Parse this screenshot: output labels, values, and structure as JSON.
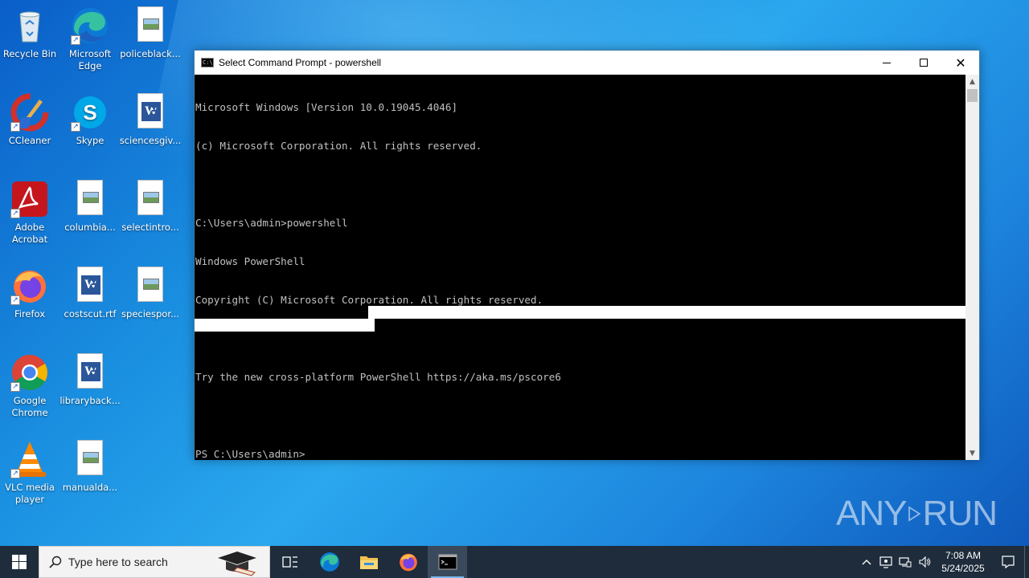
{
  "desktop": {
    "icons": [
      {
        "label": "Recycle Bin",
        "icon": "recycle-bin-icon"
      },
      {
        "label": "Microsoft Edge",
        "icon": "edge-icon"
      },
      {
        "label": "policeblack...",
        "icon": "image-file-icon"
      },
      {
        "label": "CCleaner",
        "icon": "ccleaner-icon"
      },
      {
        "label": "Skype",
        "icon": "skype-icon"
      },
      {
        "label": "sciencesgiv...",
        "icon": "word-doc-icon"
      },
      {
        "label": "Adobe Acrobat",
        "icon": "acrobat-icon"
      },
      {
        "label": "columbia...",
        "icon": "image-file-icon"
      },
      {
        "label": "selectintro...",
        "icon": "image-file-icon"
      },
      {
        "label": "Firefox",
        "icon": "firefox-icon"
      },
      {
        "label": "costscut.rtf",
        "icon": "word-doc-icon"
      },
      {
        "label": "speciespor...",
        "icon": "image-file-icon"
      },
      {
        "label": "Google Chrome",
        "icon": "chrome-icon"
      },
      {
        "label": "libraryback...",
        "icon": "word-doc-icon"
      },
      {
        "label": "VLC media player",
        "icon": "vlc-icon"
      },
      {
        "label": "manualda...",
        "icon": "image-file-icon"
      }
    ]
  },
  "cmd_window": {
    "title": "Select Command Prompt - powershell",
    "lines": [
      "Microsoft Windows [Version 10.0.19045.4046]",
      "(c) Microsoft Corporation. All rights reserved.",
      "",
      "C:\\Users\\admin>powershell",
      "Windows PowerShell",
      "Copyright (C) Microsoft Corporation. All rights reserved.",
      "",
      "Try the new cross-platform PowerShell https://aka.ms/pscore6",
      "",
      "PS C:\\Users\\admin>"
    ]
  },
  "watermark": {
    "left": "ANY",
    "right": "RUN"
  },
  "taskbar": {
    "search_placeholder": "Type here to search",
    "apps": [
      "task-view-icon",
      "edge-icon",
      "file-explorer-icon",
      "firefox-icon",
      "cmd-icon"
    ],
    "active_app": "cmd-icon",
    "time": "7:08 AM",
    "date": "5/24/2025"
  },
  "colors": {
    "terminal_bg": "#000000",
    "terminal_fg": "#c0c0c0",
    "taskbar_bg": "#1e2c3c",
    "accent": "#76b9ed"
  }
}
